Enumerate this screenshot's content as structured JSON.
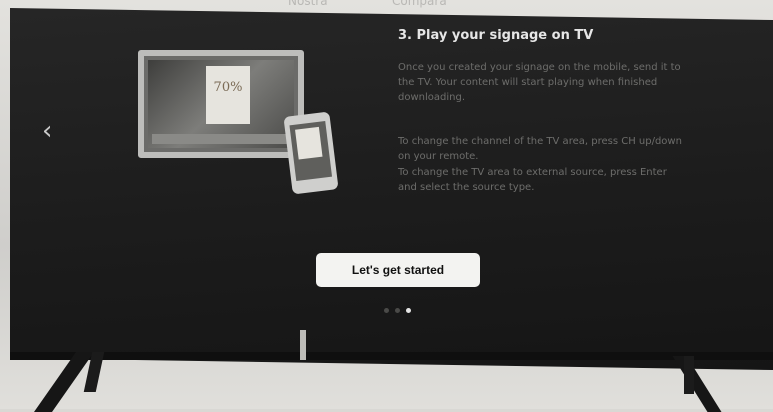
{
  "top_labels": [
    "Nostra",
    "Compara"
  ],
  "onboarding": {
    "step_title": "3. Play your signage on TV",
    "paragraph_1": "Once you created your signage on the mobile, send it to the TV. Your content will start playing when finished downloading.",
    "paragraph_2": "To change the channel of the TV area, press CH up/down on your remote.",
    "paragraph_3": "To change the TV area to external source, press Enter and select the source type.",
    "illustration_price": "70%",
    "button_label": "Let's get started",
    "current_page": 3,
    "total_pages": 3
  },
  "icons": {
    "nav_back": "chevron-left-icon"
  }
}
